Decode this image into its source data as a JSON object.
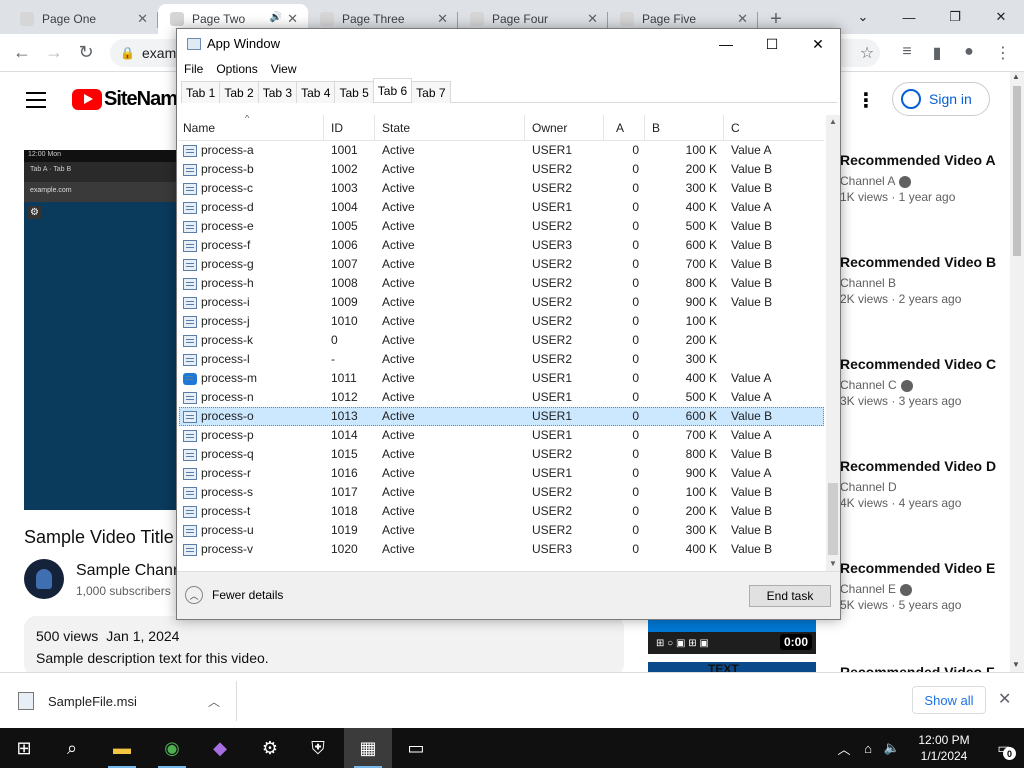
{
  "browser": {
    "tabs": [
      {
        "title": "Page One",
        "favicon_color": "#d6d6d6",
        "active": false
      },
      {
        "title": "Page Two",
        "favicon_color": "#d6d6d6",
        "active": true
      },
      {
        "title": "Page Three",
        "favicon_color": "#d6d6d6",
        "active": false
      },
      {
        "title": "Page Four",
        "favicon_color": "#d6d6d6",
        "active": false
      },
      {
        "title": "Page Five",
        "favicon_color": "#d6d6d6",
        "active": false
      }
    ],
    "new_tab": "+",
    "url": "example.com/page"
  },
  "youtube": {
    "logo_text": "SiteName",
    "sign_in": "Sign in",
    "video_title": "Sample Video Title",
    "channel_name": "Sample Channel",
    "subscribers": "1,000 subscribers",
    "views": "500 views",
    "date": "Jan 1, 2024",
    "description": "Sample description text for this video.",
    "player_status": "12:00  Mon",
    "player_tabs": "Tab A  ·  Tab B",
    "player_url": "example.com",
    "recommendations": [
      {
        "line1": "Recommended Video A",
        "line2": "",
        "channel": "Channel A",
        "meta": "1K views · 1 year ago"
      },
      {
        "line1": "Recommended Video B",
        "line2": "",
        "channel": "Channel B",
        "meta": "2K views · 2 years ago"
      },
      {
        "line1": "Recommended Video C",
        "line2": "",
        "channel": "Channel C",
        "meta": "3K views · 3 years ago"
      },
      {
        "line1": "Recommended Video D",
        "line2": "",
        "channel": "Channel D",
        "meta": "4K views · 4 years ago"
      },
      {
        "line1": "Recommended Video E",
        "line2": "",
        "channel": "Channel E",
        "meta": "5K views · 5 years ago"
      },
      {
        "line1": "Recommended Video F",
        "line2": "",
        "channel": "",
        "meta": ""
      }
    ],
    "duration": "0:00",
    "thumb_text": "TEXT"
  },
  "download": {
    "filename": "SampleFile.msi",
    "show_all": "Show all"
  },
  "task_manager": {
    "title": "App Window",
    "menu": [
      "File",
      "Options",
      "View"
    ],
    "tabs": [
      "Tab 1",
      "Tab 2",
      "Tab 3",
      "Tab 4",
      "Tab 5",
      "Tab 6",
      "Tab 7"
    ],
    "active_tab": "Tab 6",
    "columns": [
      "Name",
      "ID",
      "State",
      "Owner",
      "A",
      "B",
      "C"
    ],
    "rows": [
      {
        "name": "process-a",
        "pid": "1001",
        "status": "Active",
        "user": "USER1",
        "cpu": "0",
        "mem": "100 K",
        "uac": "Value A",
        "icon": "generic"
      },
      {
        "name": "process-b",
        "pid": "1002",
        "status": "Active",
        "user": "USER2",
        "cpu": "0",
        "mem": "200 K",
        "uac": "Value B",
        "icon": "generic"
      },
      {
        "name": "process-c",
        "pid": "1003",
        "status": "Active",
        "user": "USER2",
        "cpu": "0",
        "mem": "300 K",
        "uac": "Value B",
        "icon": "generic"
      },
      {
        "name": "process-d",
        "pid": "1004",
        "status": "Active",
        "user": "USER1",
        "cpu": "0",
        "mem": "400 K",
        "uac": "Value A",
        "icon": "generic"
      },
      {
        "name": "process-e",
        "pid": "1005",
        "status": "Active",
        "user": "USER2",
        "cpu": "0",
        "mem": "500 K",
        "uac": "Value B",
        "icon": "generic"
      },
      {
        "name": "process-f",
        "pid": "1006",
        "status": "Active",
        "user": "USER3",
        "cpu": "0",
        "mem": "600 K",
        "uac": "Value B",
        "icon": "generic"
      },
      {
        "name": "process-g",
        "pid": "1007",
        "status": "Active",
        "user": "USER2",
        "cpu": "0",
        "mem": "700 K",
        "uac": "Value B",
        "icon": "generic"
      },
      {
        "name": "process-h",
        "pid": "1008",
        "status": "Active",
        "user": "USER2",
        "cpu": "0",
        "mem": "800 K",
        "uac": "Value B",
        "icon": "generic"
      },
      {
        "name": "process-i",
        "pid": "1009",
        "status": "Active",
        "user": "USER2",
        "cpu": "0",
        "mem": "900 K",
        "uac": "Value B",
        "icon": "generic"
      },
      {
        "name": "process-j",
        "pid": "1010",
        "status": "Active",
        "user": "USER2",
        "cpu": "0",
        "mem": "100 K",
        "uac": "",
        "icon": "generic"
      },
      {
        "name": "process-k",
        "pid": "0",
        "status": "Active",
        "user": "USER2",
        "cpu": "0",
        "mem": "200 K",
        "uac": "",
        "icon": "generic"
      },
      {
        "name": "process-l",
        "pid": "-",
        "status": "Active",
        "user": "USER2",
        "cpu": "0",
        "mem": "300 K",
        "uac": "",
        "icon": "generic"
      },
      {
        "name": "process-m",
        "pid": "1011",
        "status": "Active",
        "user": "USER1",
        "cpu": "0",
        "mem": "400 K",
        "uac": "Value A",
        "icon": "gear"
      },
      {
        "name": "process-n",
        "pid": "1012",
        "status": "Active",
        "user": "USER1",
        "cpu": "0",
        "mem": "500 K",
        "uac": "Value A",
        "icon": "generic"
      },
      {
        "name": "process-o",
        "pid": "1013",
        "status": "Active",
        "user": "USER1",
        "cpu": "0",
        "mem": "600 K",
        "uac": "Value B",
        "icon": "generic",
        "selected": true
      },
      {
        "name": "process-p",
        "pid": "1014",
        "status": "Active",
        "user": "USER1",
        "cpu": "0",
        "mem": "700 K",
        "uac": "Value A",
        "icon": "generic"
      },
      {
        "name": "process-q",
        "pid": "1015",
        "status": "Active",
        "user": "USER2",
        "cpu": "0",
        "mem": "800 K",
        "uac": "Value B",
        "icon": "generic"
      },
      {
        "name": "process-r",
        "pid": "1016",
        "status": "Active",
        "user": "USER1",
        "cpu": "0",
        "mem": "900 K",
        "uac": "Value A",
        "icon": "generic"
      },
      {
        "name": "process-s",
        "pid": "1017",
        "status": "Active",
        "user": "USER2",
        "cpu": "0",
        "mem": "100 K",
        "uac": "Value B",
        "icon": "generic"
      },
      {
        "name": "process-t",
        "pid": "1018",
        "status": "Active",
        "user": "USER2",
        "cpu": "0",
        "mem": "200 K",
        "uac": "Value B",
        "icon": "generic"
      },
      {
        "name": "process-u",
        "pid": "1019",
        "status": "Active",
        "user": "USER2",
        "cpu": "0",
        "mem": "300 K",
        "uac": "Value B",
        "icon": "generic"
      },
      {
        "name": "process-v",
        "pid": "1020",
        "status": "Active",
        "user": "USER3",
        "cpu": "0",
        "mem": "400 K",
        "uac": "Value B",
        "icon": "generic"
      }
    ],
    "fewer_details": "Fewer details",
    "end_task": "End task"
  },
  "taskbar": {
    "time": "12:00 PM",
    "date": "1/1/2024",
    "notification_count": "0",
    "apps": [
      "start-icon",
      "search-icon",
      "file-explorer-icon",
      "chrome-icon",
      "visual-studio-icon",
      "settings-icon",
      "security-icon",
      "task-manager-icon",
      "terminal-icon"
    ]
  }
}
